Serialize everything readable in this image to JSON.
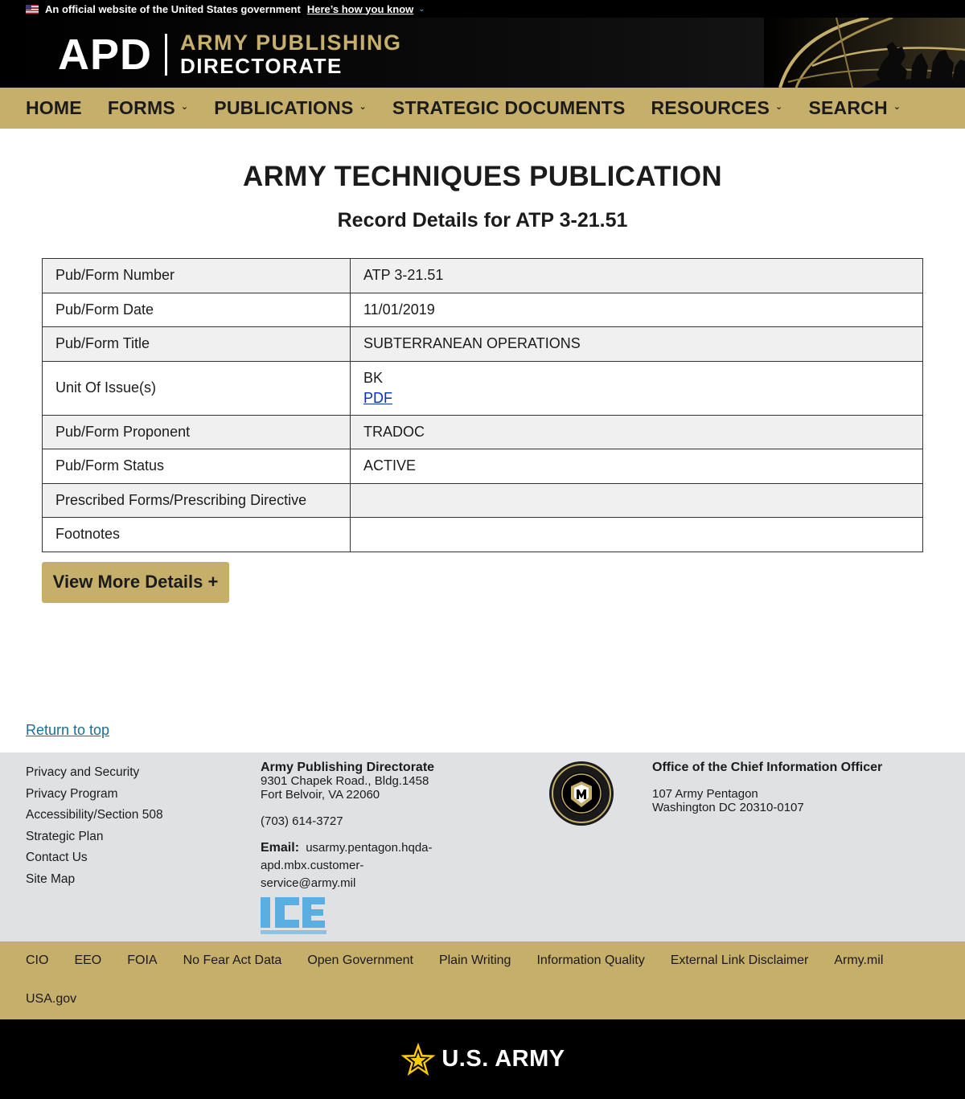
{
  "gov_banner": {
    "text": "An official website of the United States government",
    "link": "Here’s how you know"
  },
  "header": {
    "logo_abbr": "APD",
    "logo_line1": "ARMY PUBLISHING",
    "logo_line2": "DIRECTORATE"
  },
  "nav": {
    "items": [
      {
        "label": "HOME",
        "dropdown": false
      },
      {
        "label": "FORMS",
        "dropdown": true
      },
      {
        "label": "PUBLICATIONS",
        "dropdown": true
      },
      {
        "label": "STRATEGIC DOCUMENTS",
        "dropdown": false
      },
      {
        "label": "RESOURCES",
        "dropdown": true
      },
      {
        "label": "SEARCH",
        "dropdown": true
      }
    ]
  },
  "main": {
    "title": "ARMY TECHNIQUES PUBLICATION",
    "subtitle": "Record Details for ATP 3-21.51",
    "rows": [
      {
        "label": "Pub/Form Number",
        "value": "ATP 3-21.51"
      },
      {
        "label": "Pub/Form Date",
        "value": "11/01/2019"
      },
      {
        "label": "Pub/Form Title",
        "value": "SUBTERRANEAN OPERATIONS"
      },
      {
        "label": "Unit Of Issue(s)",
        "value": "BK",
        "link": "PDF"
      },
      {
        "label": "Pub/Form Proponent",
        "value": "TRADOC"
      },
      {
        "label": "Pub/Form Status",
        "value": "ACTIVE"
      },
      {
        "label": "Prescribed Forms/Prescribing Directive",
        "value": ""
      },
      {
        "label": "Footnotes",
        "value": ""
      }
    ],
    "more_button": "View More Details +"
  },
  "return_top": "Return to top",
  "footer": {
    "links": [
      "Privacy and Security",
      "Privacy Program",
      "Accessibility/Section 508",
      "Strategic Plan",
      "Contact Us",
      "Site Map"
    ],
    "apd": {
      "name": "Army Publishing Directorate",
      "address1": "9301 Chapek Road., Bldg.1458",
      "address2": "Fort Belvoir, VA 22060",
      "phone": "(703) 614-3727",
      "email_label": "Email:",
      "email": "usarmy.pentagon.hqda-apd.mbx.customer-service@army.mil"
    },
    "cio": {
      "name": "Office of the Chief Information Officer",
      "address1": "107 Army Pentagon",
      "address2": "Washington DC 20310-0107"
    },
    "bottom_links": [
      "CIO",
      "EEO",
      "FOIA",
      "No Fear Act Data",
      "Open Government",
      "Plain Writing",
      "Information Quality",
      "External Link Disclaimer",
      "Army.mil",
      "USA.gov"
    ],
    "army_wordmark": "U.S. ARMY"
  },
  "colors": {
    "gold": "#c6ae6b",
    "black": "#000000",
    "footer_gray": "#dfe1e2",
    "link_blue": "#0b2fb9"
  }
}
